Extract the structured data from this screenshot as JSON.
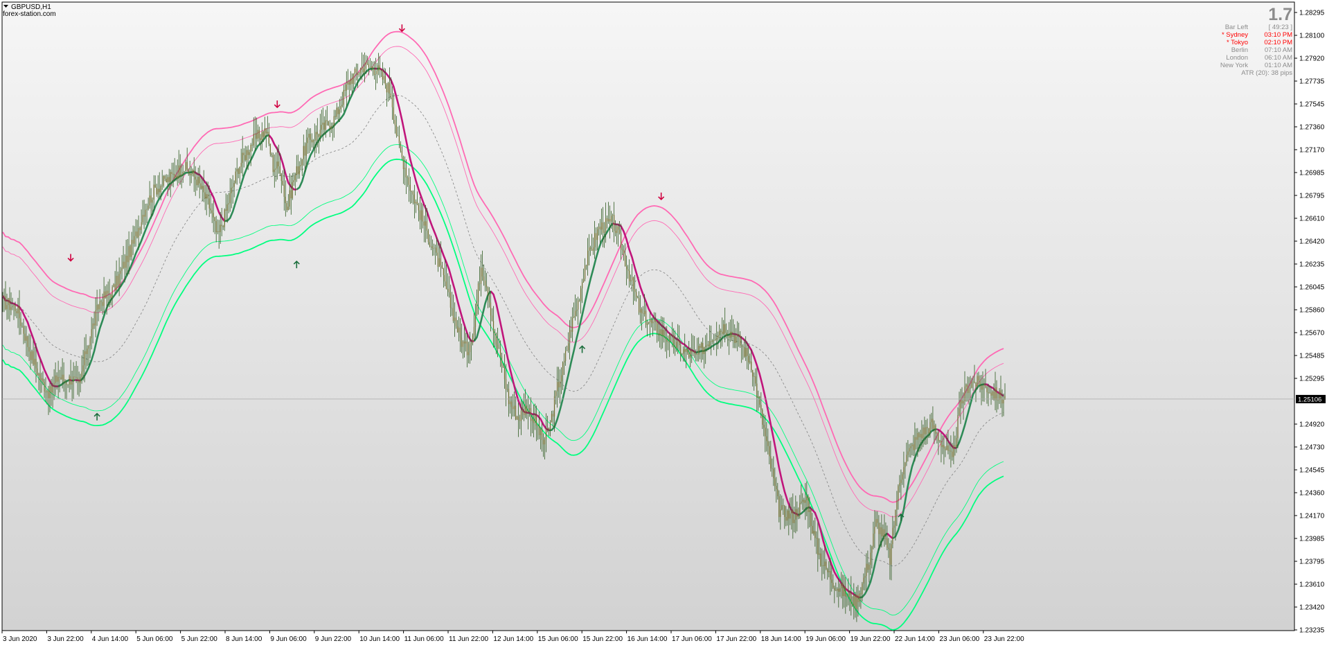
{
  "header": {
    "symbol_label": "GBPUSD,H1",
    "watermark": "forex-station.com"
  },
  "info_panel": {
    "big_value": "1.7",
    "rows": [
      {
        "label": "Bar Left",
        "value": "[ 49:23 ]",
        "color": "#8c8c8c"
      },
      {
        "label": "* Sydney",
        "value": "03:10 PM",
        "color": "#ff0000"
      },
      {
        "label": "* Tokyo",
        "value": "02:10 PM",
        "color": "#ff0000"
      },
      {
        "label": "Berlin",
        "value": "07:10 AM",
        "color": "#8c8c8c"
      },
      {
        "label": "London",
        "value": "06:10 AM",
        "color": "#8c8c8c"
      },
      {
        "label": "New York",
        "value": "01:10 AM",
        "color": "#8c8c8c"
      }
    ],
    "atr_text": "ATR (20): 38 pips"
  },
  "colors": {
    "background_top": "#f6f6f6",
    "background_bottom": "#d2d2d2",
    "candle_body": "#6b6b2a",
    "candle_wick": "#2e5a1f",
    "line_dark_green": "#2e8b57",
    "line_magenta": "#c0157b",
    "band_pink": "#ff69b4",
    "band_green": "#00ff7f",
    "mid_dashed": "#808080",
    "arrow_up": "#1a6e3c",
    "arrow_down": "#d00040",
    "current_price_line": "#a9a9a9"
  },
  "chart_data": {
    "type": "candlestick",
    "symbol": "GBPUSD",
    "timeframe": "H1",
    "y_ticks": [
      "1.28295",
      "1.28100",
      "1.27920",
      "1.27735",
      "1.27545",
      "1.27360",
      "1.27170",
      "1.26985",
      "1.26795",
      "1.26610",
      "1.26420",
      "1.26235",
      "1.26045",
      "1.25860",
      "1.25670",
      "1.25485",
      "1.25295",
      "1.24920",
      "1.24730",
      "1.24545",
      "1.24360",
      "1.24170",
      "1.23985",
      "1.23795",
      "1.23610",
      "1.23420",
      "1.23235"
    ],
    "ylim": [
      1.2322,
      1.2834
    ],
    "current_price": "1.25106",
    "current_price_value": 1.25106,
    "x_ticks": [
      "3 Jun 2020",
      "3 Jun 22:00",
      "4 Jun 14:00",
      "5 Jun 06:00",
      "5 Jun 22:00",
      "8 Jun 14:00",
      "9 Jun 06:00",
      "9 Jun 22:00",
      "10 Jun 14:00",
      "11 Jun 06:00",
      "11 Jun 22:00",
      "12 Jun 14:00",
      "15 Jun 06:00",
      "15 Jun 22:00",
      "16 Jun 14:00",
      "17 Jun 06:00",
      "17 Jun 22:00",
      "18 Jun 14:00",
      "19 Jun 06:00",
      "19 Jun 22:00",
      "22 Jun 14:00",
      "23 Jun 06:00",
      "23 Jun 22:00"
    ],
    "close_path": [
      [
        0,
        1.259
      ],
      [
        10,
        1.2585
      ],
      [
        20,
        1.2548
      ],
      [
        28,
        1.2525
      ],
      [
        34,
        1.2515
      ],
      [
        40,
        1.253
      ],
      [
        45,
        1.2525
      ],
      [
        50,
        1.2528
      ],
      [
        55,
        1.252
      ],
      [
        60,
        1.255
      ],
      [
        70,
        1.259
      ],
      [
        80,
        1.26
      ],
      [
        95,
        1.264
      ],
      [
        102,
        1.2665
      ],
      [
        110,
        1.2682
      ],
      [
        120,
        1.269
      ],
      [
        130,
        1.27
      ],
      [
        140,
        1.269
      ],
      [
        150,
        1.2665
      ],
      [
        155,
        1.2642
      ],
      [
        160,
        1.266
      ],
      [
        170,
        1.27
      ],
      [
        180,
        1.272
      ],
      [
        190,
        1.273
      ],
      [
        195,
        1.27
      ],
      [
        200,
        1.27
      ],
      [
        205,
        1.2665
      ],
      [
        210,
        1.269
      ],
      [
        220,
        1.272
      ],
      [
        230,
        1.273
      ],
      [
        240,
        1.274
      ],
      [
        250,
        1.277
      ],
      [
        260,
        1.2782
      ],
      [
        270,
        1.278
      ],
      [
        280,
        1.276
      ],
      [
        285,
        1.272
      ],
      [
        290,
        1.27
      ],
      [
        295,
        1.268
      ],
      [
        305,
        1.265
      ],
      [
        315,
        1.262
      ],
      [
        325,
        1.258
      ],
      [
        330,
        1.256
      ],
      [
        335,
        1.255
      ],
      [
        340,
        1.257
      ],
      [
        345,
        1.262
      ],
      [
        350,
        1.26
      ],
      [
        355,
        1.256
      ],
      [
        360,
        1.254
      ],
      [
        365,
        1.251
      ],
      [
        372,
        1.2495
      ],
      [
        378,
        1.2505
      ],
      [
        385,
        1.249
      ],
      [
        390,
        1.2475
      ],
      [
        395,
        1.249
      ],
      [
        400,
        1.252
      ],
      [
        405,
        1.254
      ],
      [
        410,
        1.257
      ],
      [
        415,
        1.259
      ],
      [
        420,
        1.262
      ],
      [
        430,
        1.265
      ],
      [
        440,
        1.2655
      ],
      [
        445,
        1.264
      ],
      [
        450,
        1.262
      ],
      [
        455,
        1.26
      ],
      [
        460,
        1.258
      ],
      [
        470,
        1.257
      ],
      [
        480,
        1.256
      ],
      [
        490,
        1.255
      ],
      [
        500,
        1.2545
      ],
      [
        510,
        1.256
      ],
      [
        520,
        1.257
      ],
      [
        530,
        1.256
      ],
      [
        540,
        1.254
      ],
      [
        545,
        1.251
      ],
      [
        550,
        1.248
      ],
      [
        555,
        1.245
      ],
      [
        560,
        1.242
      ],
      [
        570,
        1.2415
      ],
      [
        580,
        1.243
      ],
      [
        585,
        1.24
      ],
      [
        590,
        1.238
      ],
      [
        595,
        1.237
      ],
      [
        600,
        1.236
      ],
      [
        610,
        1.235
      ],
      [
        615,
        1.2345
      ],
      [
        620,
        1.236
      ],
      [
        625,
        1.238
      ],
      [
        630,
        1.241
      ],
      [
        635,
        1.24
      ],
      [
        640,
        1.238
      ],
      [
        645,
        1.243
      ],
      [
        650,
        1.246
      ],
      [
        660,
        1.248
      ],
      [
        670,
        1.249
      ],
      [
        680,
        1.247
      ],
      [
        685,
        1.246
      ],
      [
        690,
        1.25
      ],
      [
        695,
        1.252
      ],
      [
        700,
        1.2525
      ],
      [
        710,
        1.252
      ],
      [
        715,
        1.2515
      ],
      [
        722,
        1.2511
      ]
    ],
    "arrows_up": [
      [
        68,
        1.2496
      ],
      [
        212,
        1.262
      ],
      [
        418,
        1.2551
      ],
      [
        648,
        1.2414
      ]
    ],
    "arrows_down": [
      [
        49,
        1.2626
      ],
      [
        198,
        1.2751
      ],
      [
        288,
        1.2813
      ],
      [
        475,
        1.2676
      ]
    ],
    "indicators": [
      {
        "name": "Dark green trend line",
        "color": "#2e8b57"
      },
      {
        "name": "Magenta trend line",
        "color": "#c0157b"
      },
      {
        "name": "Upper pink band",
        "color": "#ff69b4"
      },
      {
        "name": "Lower green band",
        "color": "#00ff7f"
      },
      {
        "name": "Middle dashed line",
        "color": "#808080"
      }
    ]
  }
}
